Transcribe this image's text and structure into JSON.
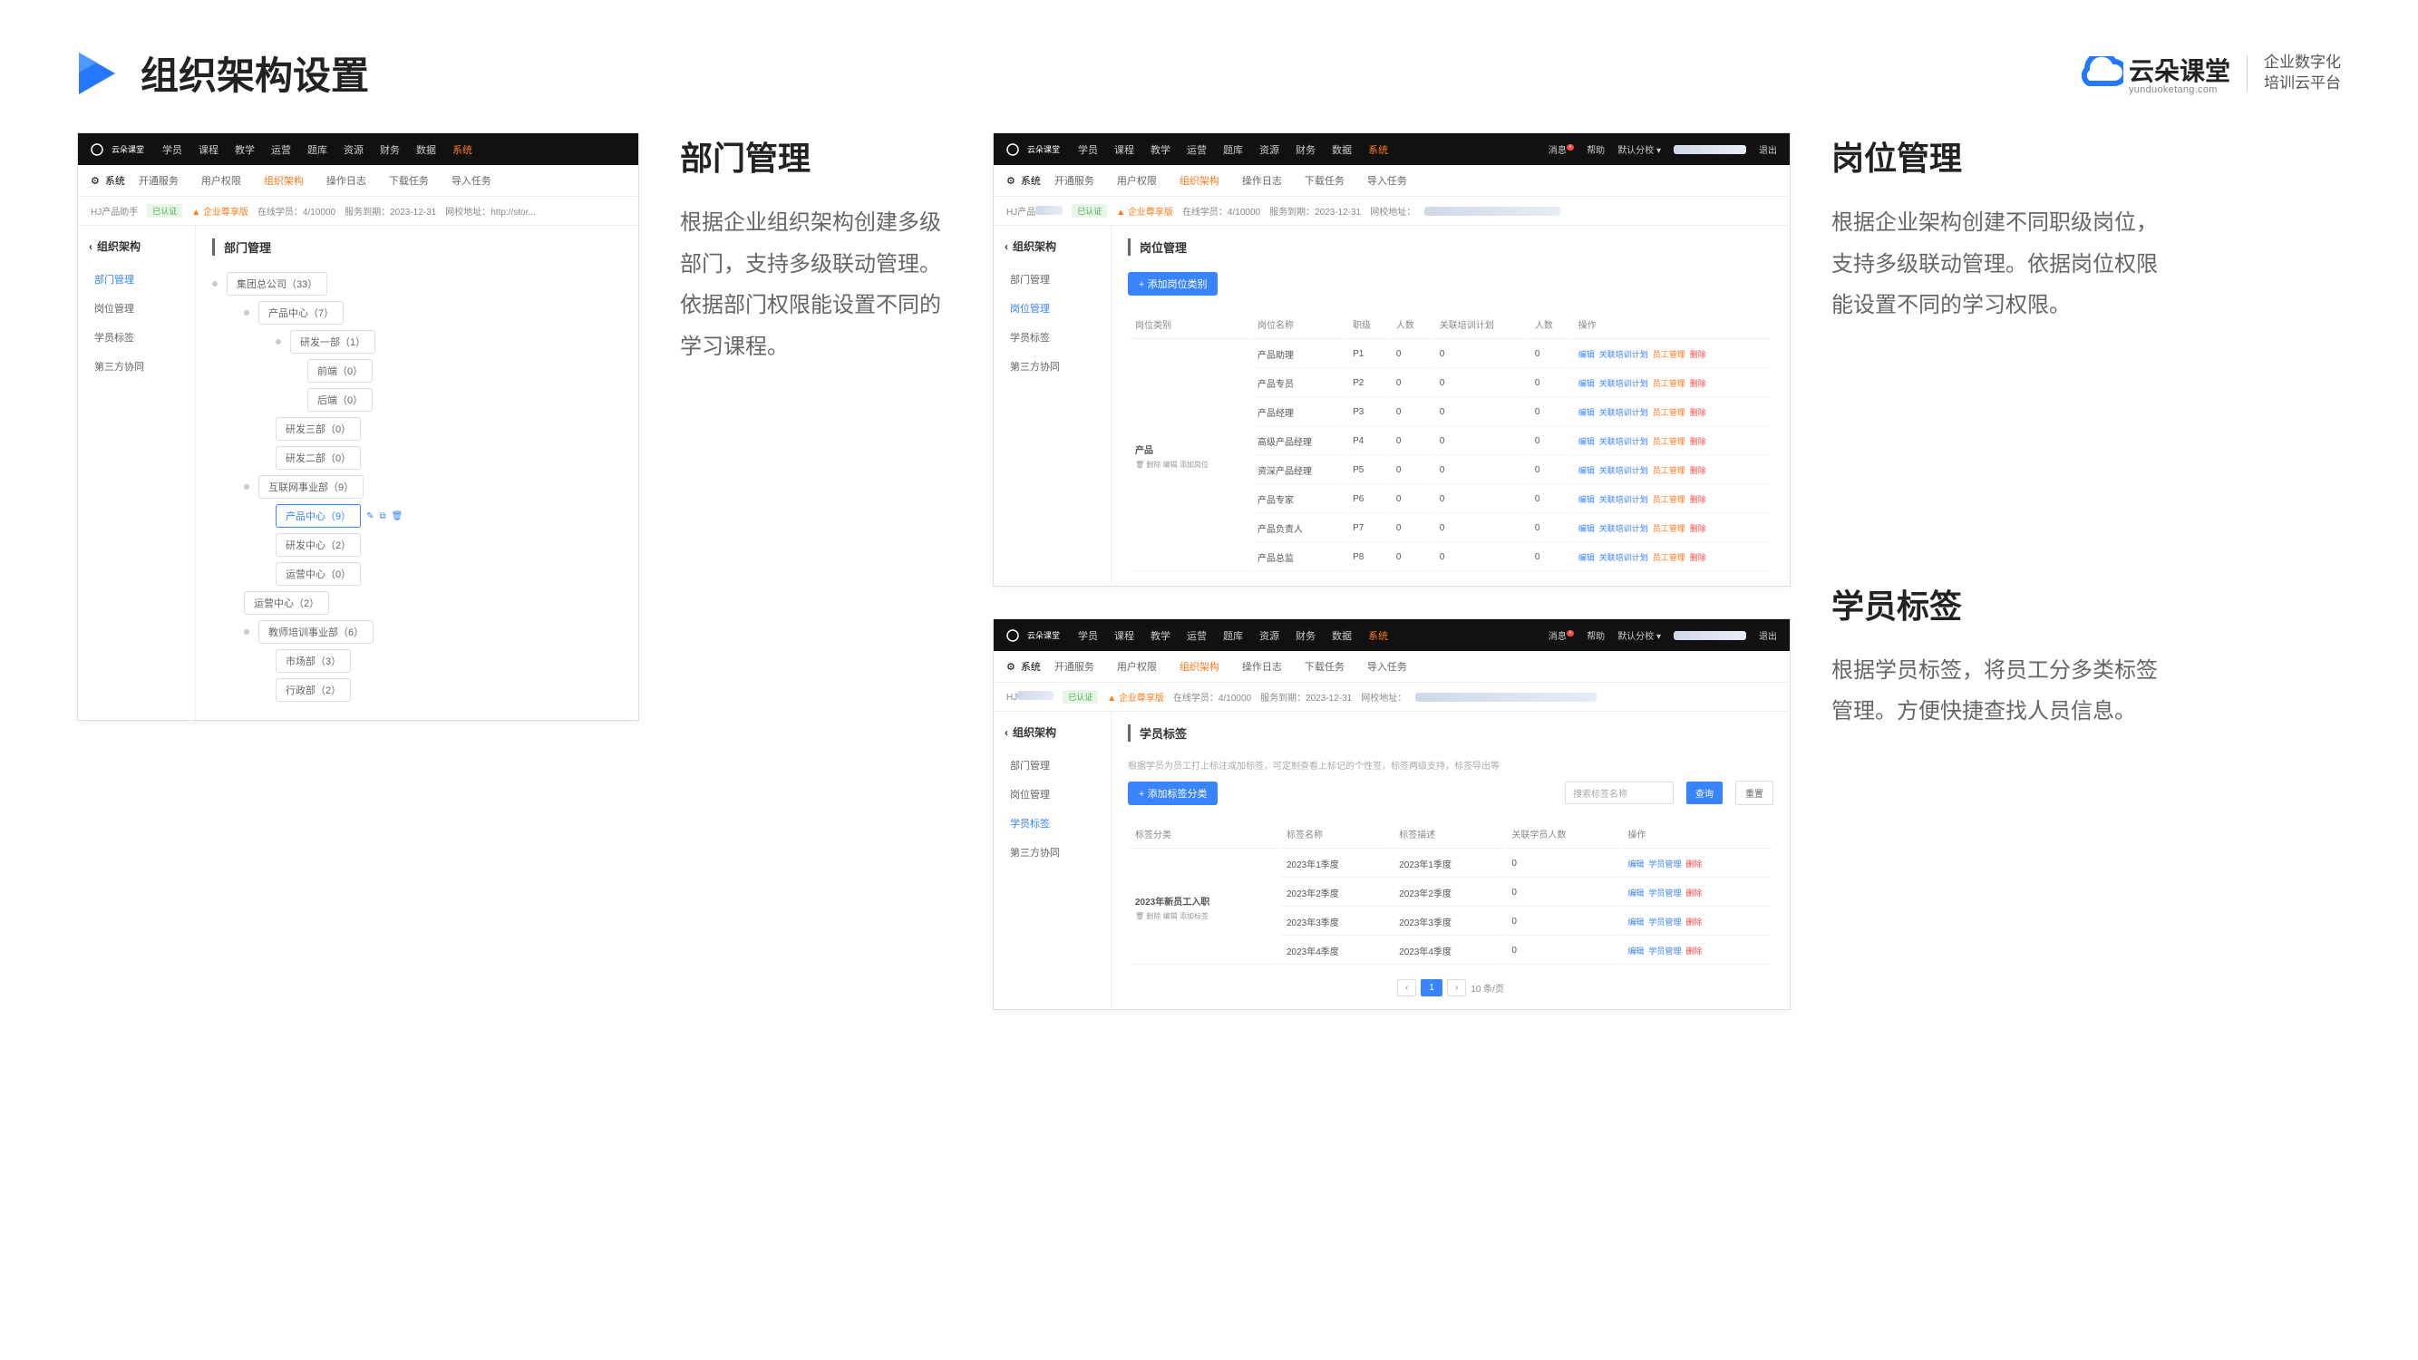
{
  "header": {
    "title": "组织架构设置",
    "brand_name": "云朵课堂",
    "brand_domain": "yunduoketang.com",
    "brand_tagline": "企业数字化\n培训云平台"
  },
  "section1": {
    "title": "部门管理",
    "desc": "根据企业组织架构创建多级部门，支持多级联动管理。依据部门权限能设置不同的学习课程。"
  },
  "section2": {
    "title": "岗位管理",
    "desc": "根据企业架构创建不同职级岗位，支持多级联动管理。依据岗位权限能设置不同的学习权限。"
  },
  "section3": {
    "title": "学员标签",
    "desc": "根据学员标签，将员工分多类标签管理。方便快捷查找人员信息。"
  },
  "shot": {
    "top_nav": [
      "学员",
      "课程",
      "教学",
      "运营",
      "题库",
      "资源",
      "财务",
      "数据",
      "系统"
    ],
    "sub_nav_label": "系统",
    "sub_nav": [
      "开通服务",
      "用户权限",
      "组织架构",
      "操作日志",
      "下载任务",
      "导入任务"
    ],
    "status_company": "HJ产品助手",
    "status_verified": "已认证",
    "status_plan": "企业尊享版",
    "status_students": "在线学员：4/10000",
    "status_expire": "服务到期：2023-12-31",
    "status_url": "网校地址：http://stor...",
    "status_url2": "网校地址：",
    "side_head": "组织架构",
    "side_items": [
      "部门管理",
      "岗位管理",
      "学员标签",
      "第三方协同"
    ]
  },
  "tree": {
    "panel_title": "部门管理",
    "root": "集团总公司（33）",
    "n1": "产品中心（7）",
    "n1_1": "研发一部（1）",
    "n1_1_1": "前端（0）",
    "n1_1_2": "后端（0）",
    "n1_2": "研发三部（0）",
    "n1_3": "研发二部（0）",
    "n2": "互联网事业部（9）",
    "n2_1": "产品中心（9）",
    "n2_2": "研发中心（2）",
    "n2_3": "运营中心（0）",
    "n3": "运营中心（2）",
    "n4": "教师培训事业部（6）",
    "n4_1": "市场部（3）",
    "n4_2": "行政部（2）"
  },
  "job": {
    "panel_title": "岗位管理",
    "add_btn": "+ 添加岗位类别",
    "headers": [
      "岗位类别",
      "岗位名称",
      "职级",
      "人数",
      "关联培训计划",
      "人数",
      "操作"
    ],
    "category": "产品",
    "cat_ops": "删除 编辑 添加岗位",
    "rows": [
      {
        "name": "产品助理",
        "level": "P1",
        "c1": "0",
        "c2": "0"
      },
      {
        "name": "产品专员",
        "level": "P2",
        "c1": "0",
        "c2": "0"
      },
      {
        "name": "产品经理",
        "level": "P3",
        "c1": "0",
        "c2": "0"
      },
      {
        "name": "高级产品经理",
        "level": "P4",
        "c1": "0",
        "c2": "0"
      },
      {
        "name": "资深产品经理",
        "level": "P5",
        "c1": "0",
        "c2": "0"
      },
      {
        "name": "产品专家",
        "level": "P6",
        "c1": "0",
        "c2": "0"
      },
      {
        "name": "产品负责人",
        "level": "P7",
        "c1": "0",
        "c2": "0"
      },
      {
        "name": "产品总监",
        "level": "P8",
        "c1": "0",
        "c2": "0"
      }
    ],
    "ops_edit": "编辑",
    "ops_plan": "关联培训计划",
    "ops_emp": "员工管理",
    "ops_del": "删除"
  },
  "tag": {
    "panel_title": "学员标签",
    "hint": "根据学员为员工打上标注或加标签，可定制查看上标记的个性签，标签两级支持，标签导出等",
    "add_btn": "+ 添加标签分类",
    "search_ph": "搜索标签名称",
    "btn_search": "查询",
    "btn_reset": "重置",
    "headers": [
      "标签分类",
      "标签名称",
      "标签描述",
      "关联学员人数",
      "操作"
    ],
    "category": "2023年新员工入职",
    "cat_ops": "删除 编辑 添加标签",
    "rows": [
      {
        "name": "2023年1季度",
        "desc": "2023年1季度",
        "count": "0"
      },
      {
        "name": "2023年2季度",
        "desc": "2023年2季度",
        "count": "0"
      },
      {
        "name": "2023年3季度",
        "desc": "2023年3季度",
        "count": "0"
      },
      {
        "name": "2023年4季度",
        "desc": "2023年4季度",
        "count": "0"
      }
    ],
    "ops_edit": "编辑",
    "ops_mgr": "学员管理",
    "ops_del": "删除",
    "pager_info": "10 条/页"
  }
}
